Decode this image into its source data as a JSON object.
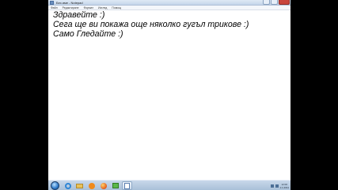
{
  "window": {
    "title": "Без име - Notepad",
    "menu": [
      "Файл",
      "Редактиране",
      "Формат",
      "Изглед",
      "Помощ"
    ]
  },
  "editor": {
    "lines": [
      "Здравейте :)",
      "Сега ще ви покажа още няколко гугъл трикове :)",
      "Само Гледайте :)"
    ]
  },
  "taskbar": {
    "apps": [
      "internet-explorer-icon",
      "folder-icon",
      "media-player-icon",
      "firefox-icon",
      "green-app-icon",
      "notepad-icon"
    ],
    "clock_time": "12:00",
    "clock_date": "1.1.2011"
  },
  "colors": {
    "editor_background": "#ffffff",
    "text": "#000000",
    "letterbox": "#000000",
    "taskbar": "#b8cce2"
  }
}
